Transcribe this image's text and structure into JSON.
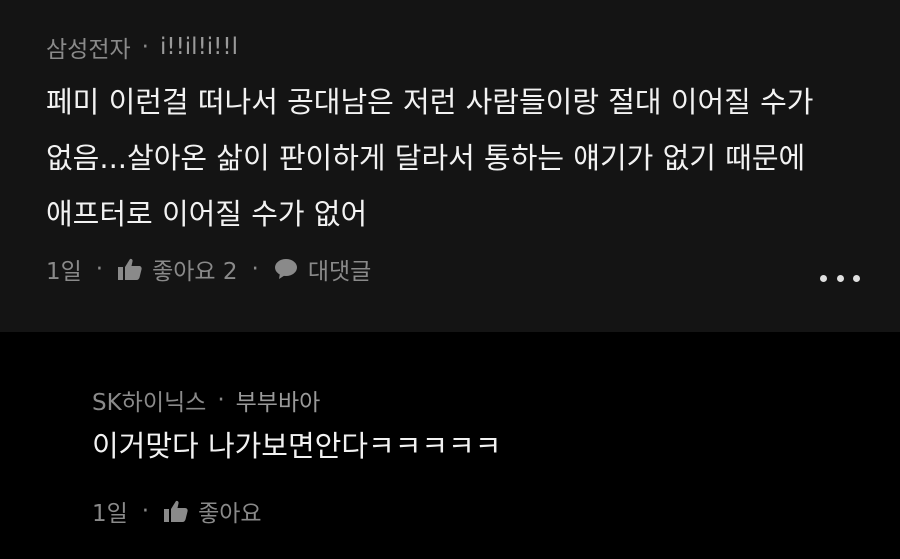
{
  "comments": [
    {
      "company": "삼성전자",
      "author": "i!!il!i!!l",
      "lines": [
        "페미 이런걸 떠나서 공대남은 저런 사람들이랑 절대 이어질 수가",
        "없음...살아온 삶이 판이하게 달라서 통하는 얘기가 없기 때문에",
        "애프터로 이어질 수가 없어"
      ],
      "time": "1일",
      "like_label": "좋아요 2",
      "reply_label": "대댓글"
    },
    {
      "company": "SK하이닉스",
      "author": "부부바아",
      "lines": [
        "이거맞다 나가보면안다ㅋㅋㅋㅋㅋ"
      ],
      "time": "1일",
      "like_label": "좋아요"
    }
  ],
  "icons": {
    "like": "thumbs-up-icon",
    "reply": "speech-bubble-icon",
    "more": "more-horizontal-icon"
  },
  "colors": {
    "background": "#000000",
    "comment_bg": "#141414",
    "text": "#f2f2f2",
    "meta": "#8a8a8a"
  }
}
